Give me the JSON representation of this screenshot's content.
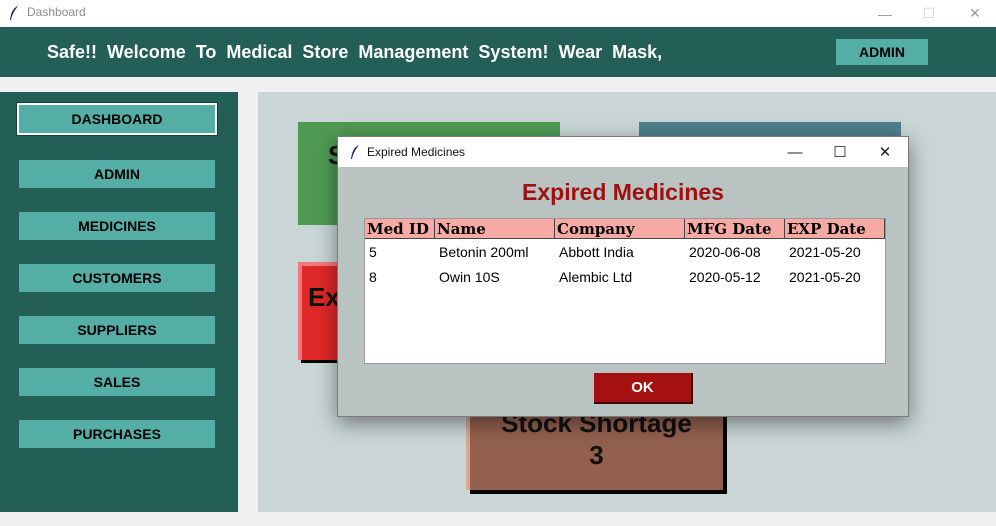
{
  "window": {
    "title": "Dashboard",
    "controls": {
      "minimize": "—",
      "maximize": "☐",
      "close": "✕"
    }
  },
  "header": {
    "marquee_text": "Safe!!  Welcome  To  Medical  Store  Management  System!  Wear  Mask,",
    "admin_button": "ADMIN",
    "colors": {
      "background": "#235e57",
      "button": "#55aea6"
    }
  },
  "sidebar": {
    "items": [
      {
        "label": "DASHBOARD",
        "active": true
      },
      {
        "label": "ADMIN",
        "active": false
      },
      {
        "label": "MEDICINES",
        "active": false
      },
      {
        "label": "CUSTOMERS",
        "active": false
      },
      {
        "label": "SUPPLIERS",
        "active": false
      },
      {
        "label": "SALES",
        "active": false
      },
      {
        "label": "PURCHASES",
        "active": false
      }
    ]
  },
  "cards": {
    "green_partial": "S",
    "expired_partial": "Ex",
    "stock_shortage": {
      "label": "Stock Shortage",
      "value": "3"
    }
  },
  "dialog": {
    "title": "Expired Medicines",
    "heading": "Expired Medicines",
    "columns": [
      "Med ID",
      "Name",
      "Company",
      "MFG Date",
      "EXP Date"
    ],
    "rows": [
      [
        "5",
        "Betonin 200ml",
        "Abbott India",
        "2020-06-08",
        "2021-05-20"
      ],
      [
        "8",
        "Owin 10S",
        "Alembic Ltd",
        "2020-05-12",
        "2021-05-20"
      ]
    ],
    "ok_button": "OK",
    "controls": {
      "minimize": "—",
      "maximize": "☐",
      "close": "✕"
    },
    "colors": {
      "heading": "#a01010",
      "ok_button": "#a51010",
      "table_header": "#f7a9a3"
    }
  }
}
